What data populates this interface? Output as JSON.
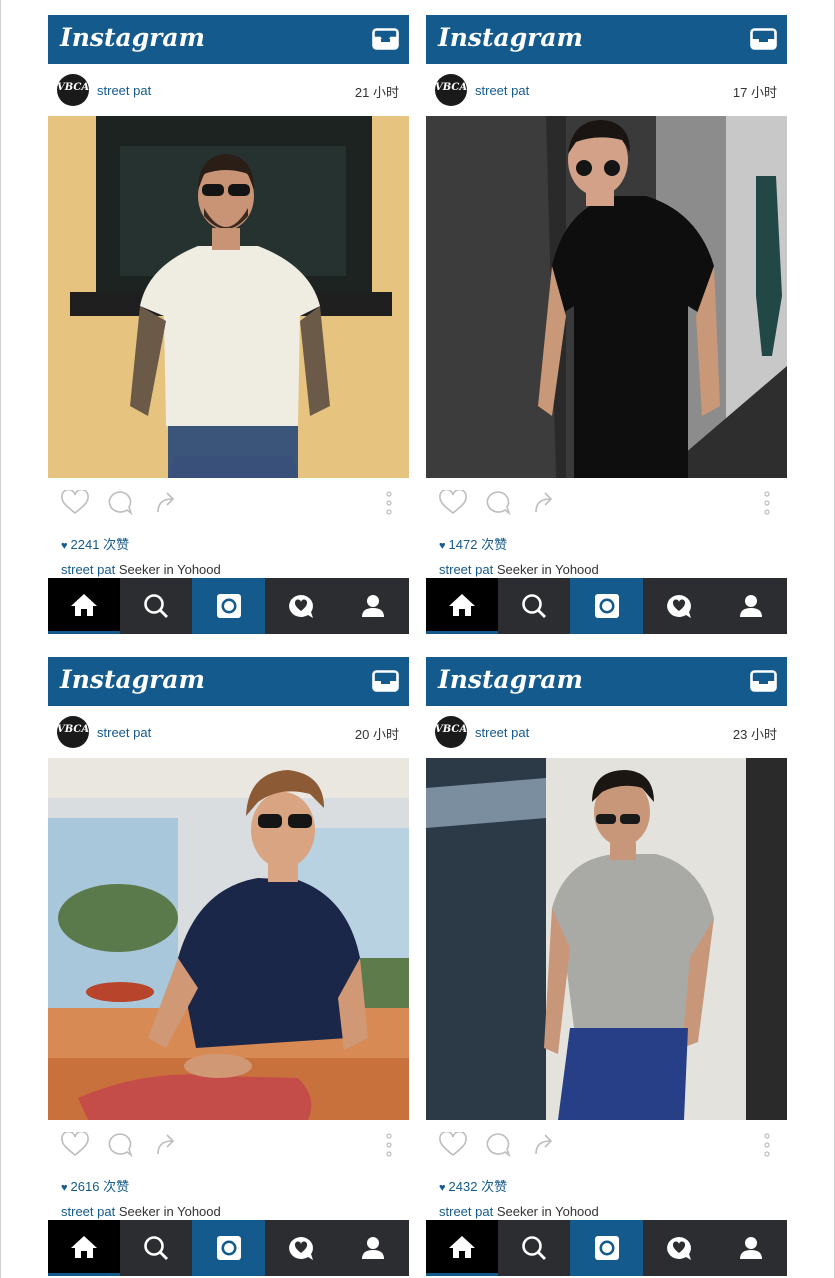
{
  "posts": [
    {
      "brand": "Instagram",
      "user": "street pat",
      "avatar_text": "VBCA",
      "time": "21 小时",
      "likes": "2241 次赞",
      "caption_user": "street pat",
      "caption_text": " Seeker in Yohood"
    },
    {
      "brand": "Instagram",
      "user": "street pat",
      "avatar_text": "VBCA",
      "time": "17 小时",
      "likes": "1472 次赞",
      "caption_user": "street pat",
      "caption_text": " Seeker in Yohood"
    },
    {
      "brand": "Instagram",
      "user": "street pat",
      "avatar_text": "VBCA",
      "time": "20 小时",
      "likes": "2616 次赞",
      "caption_user": "street pat",
      "caption_text": " Seeker in Yohood"
    },
    {
      "brand": "Instagram",
      "user": "street pat",
      "avatar_text": "VBCA",
      "time": "23 小时",
      "likes": "2432 次赞",
      "caption_user": "street pat",
      "caption_text": " Seeker in Yohood"
    }
  ],
  "icons": {
    "topbar": "inbox-icon",
    "actions": [
      "heart-outline-icon",
      "comment-icon",
      "share-arrow-icon",
      "more-vertical-icon"
    ],
    "nav": [
      "home-icon",
      "search-icon",
      "camera-icon",
      "activity-heart-icon",
      "profile-icon"
    ]
  },
  "colors": {
    "brand": "#155a8c",
    "navbar": "#2b2d31",
    "nav_active": "#000000"
  }
}
